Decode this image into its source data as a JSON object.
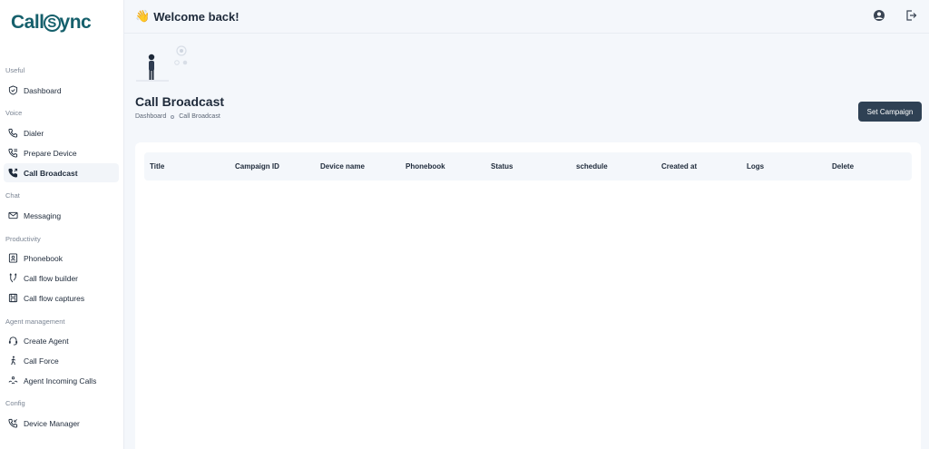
{
  "app": {
    "logo_text_a": "Call",
    "logo_text_s": "S",
    "logo_text_b": "ync"
  },
  "sidebar": {
    "sections": [
      {
        "label": "Useful"
      },
      {
        "label": "Voice"
      },
      {
        "label": "Chat"
      },
      {
        "label": "Productivity"
      },
      {
        "label": "Agent management"
      },
      {
        "label": "Config"
      }
    ],
    "items": [
      {
        "label": "Dashboard",
        "icon": "shield-check-icon"
      },
      {
        "label": "Dialer",
        "icon": "phone-icon"
      },
      {
        "label": "Prepare Device",
        "icon": "phone-settings-icon"
      },
      {
        "label": "Call Broadcast",
        "icon": "phone-outgoing-icon",
        "active": true
      },
      {
        "label": "Messaging",
        "icon": "mail-icon"
      },
      {
        "label": "Phonebook",
        "icon": "contact-book-icon"
      },
      {
        "label": "Call flow builder",
        "icon": "flow-icon"
      },
      {
        "label": "Call flow captures",
        "icon": "save-icon"
      },
      {
        "label": "Create Agent",
        "icon": "agent-icon"
      },
      {
        "label": "Call Force",
        "icon": "walk-icon"
      },
      {
        "label": "Agent Incoming Calls",
        "icon": "incoming-calls-icon"
      },
      {
        "label": "Device Manager",
        "icon": "phone-incoming-icon"
      }
    ]
  },
  "topbar": {
    "welcome": "Welcome back!",
    "hand_icon": "waving-hand-icon"
  },
  "page": {
    "title": "Call Broadcast",
    "breadcrumb": [
      "Dashboard",
      "Call Broadcast"
    ],
    "primary_button": "Set Campaign"
  },
  "table": {
    "columns": [
      "Title",
      "Campaign ID",
      "Device name",
      "Phonebook",
      "Status",
      "schedule",
      "Created at",
      "Logs",
      "Delete"
    ],
    "rows": []
  },
  "colors": {
    "brand": "#16606c",
    "button": "#2f4154",
    "background": "#f4f7fb"
  }
}
